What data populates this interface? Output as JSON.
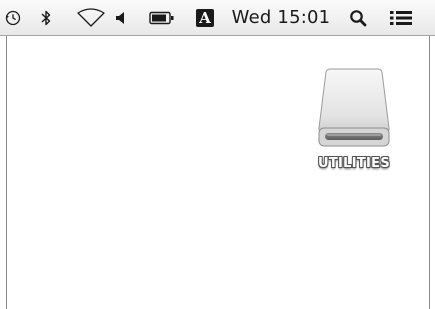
{
  "menubar": {
    "icons": {
      "time_machine": "time-machine-icon",
      "bluetooth": "bluetooth-icon",
      "wifi": "wifi-icon",
      "volume": "volume-icon",
      "battery": "battery-icon",
      "spotlight": "spotlight-search-icon",
      "notifications": "notification-center-icon"
    },
    "input_source": "A",
    "clock": "Wed 15:01"
  },
  "desktop": {
    "items": [
      {
        "label": "UTILITIES",
        "icon": "external-drive-icon"
      }
    ]
  }
}
